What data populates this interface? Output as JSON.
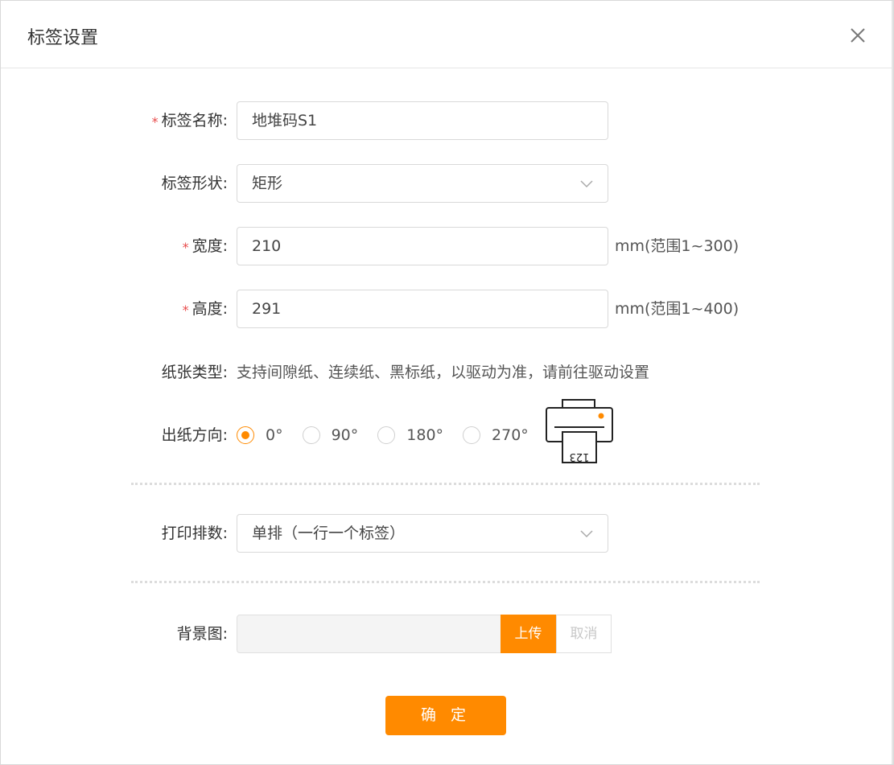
{
  "dialog": {
    "title": "标签设置",
    "close_icon": "close-icon"
  },
  "form": {
    "name": {
      "label": "标签名称:",
      "required": "*",
      "value": "地堆码S1"
    },
    "shape": {
      "label": "标签形状:",
      "value": "矩形",
      "icon": "chevron-down-icon"
    },
    "width": {
      "label": "宽度:",
      "required": "*",
      "value": "210",
      "suffix": "mm(范围1~300)"
    },
    "height": {
      "label": "高度:",
      "required": "*",
      "value": "291",
      "suffix": "mm(范围1~400)"
    },
    "paper_type": {
      "label": "纸张类型:",
      "text": "支持间隙纸、连续纸、黑标纸，以驱动为准，请前往驱动设置"
    },
    "direction": {
      "label": "出纸方向:",
      "options": [
        "0°",
        "90°",
        "180°",
        "270°"
      ],
      "selected": "0°",
      "printer_icon": "printer-icon",
      "printer_text": "123"
    },
    "layout": {
      "label": "打印排数:",
      "value": "单排（一行一个标签）",
      "icon": "chevron-down-icon"
    },
    "background": {
      "label": "背景图:",
      "upload_label": "上传",
      "cancel_label": "取消"
    }
  },
  "confirm_label": "确 定",
  "colors": {
    "accent": "#ff8a00",
    "required": "#e84a4a"
  }
}
